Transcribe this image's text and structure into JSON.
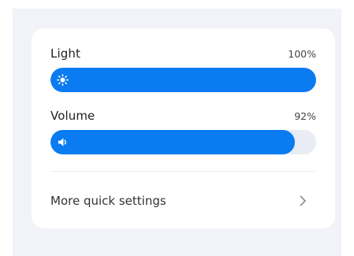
{
  "colors": {
    "accent": "#0a7bf0",
    "track": "#e9ecf2",
    "background": "#f1f3f8",
    "card": "#ffffff"
  },
  "light": {
    "label": "Light",
    "value_text": "100%",
    "level": 1.0,
    "icon": "sun-icon"
  },
  "volume": {
    "label": "Volume",
    "value_text": "92%",
    "level": 0.92,
    "icon": "speaker-icon"
  },
  "more": {
    "label": "More quick settings",
    "icon": "chevron-right-icon"
  }
}
